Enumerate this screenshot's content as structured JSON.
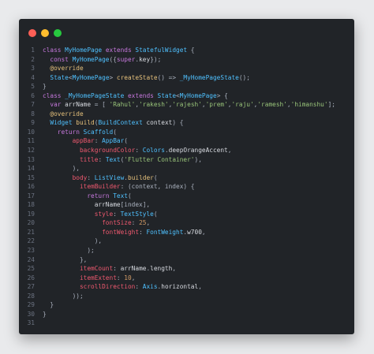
{
  "window": {
    "controls": [
      "close",
      "minimize",
      "maximize"
    ],
    "colors": {
      "background": "#212428",
      "close": "#ff5f56",
      "minimize": "#ffbd2e",
      "maximize": "#27c93f"
    }
  },
  "code_lines": [
    {
      "n": "1",
      "tokens": [
        [
          "kw",
          "class "
        ],
        [
          "type",
          "MyHomePage "
        ],
        [
          "kw",
          "extends "
        ],
        [
          "type",
          "StatefulWidget"
        ],
        [
          "punct",
          " {"
        ]
      ]
    },
    {
      "n": "2",
      "tokens": [
        [
          "plain",
          "  "
        ],
        [
          "kw",
          "const "
        ],
        [
          "type",
          "MyHomePage"
        ],
        [
          "punct",
          "({"
        ],
        [
          "kw",
          "super"
        ],
        [
          "punct",
          "."
        ],
        [
          "plain",
          "key"
        ],
        [
          "punct",
          "});"
        ]
      ]
    },
    {
      "n": "3",
      "tokens": [
        [
          "plain",
          "  "
        ],
        [
          "anno",
          "@override"
        ]
      ]
    },
    {
      "n": "4",
      "tokens": [
        [
          "plain",
          "  "
        ],
        [
          "type",
          "State"
        ],
        [
          "punct",
          "<"
        ],
        [
          "type",
          "MyHomePage"
        ],
        [
          "punct",
          "> "
        ],
        [
          "fn",
          "createState"
        ],
        [
          "punct",
          "() => "
        ],
        [
          "type",
          "_MyHomePageState"
        ],
        [
          "punct",
          "();"
        ]
      ]
    },
    {
      "n": "5",
      "tokens": [
        [
          "punct",
          "}"
        ]
      ]
    },
    {
      "n": "6",
      "tokens": [
        [
          "kw",
          "class "
        ],
        [
          "type",
          "_MyHomePageState "
        ],
        [
          "kw",
          "extends "
        ],
        [
          "type",
          "State"
        ],
        [
          "punct",
          "<"
        ],
        [
          "type",
          "MyHomePage"
        ],
        [
          "punct",
          "> {"
        ]
      ]
    },
    {
      "n": "7",
      "tokens": [
        [
          "plain",
          "  "
        ],
        [
          "kw",
          "var "
        ],
        [
          "plain",
          "arrName"
        ],
        [
          "punct",
          " = [ "
        ],
        [
          "str",
          "'Rahul'"
        ],
        [
          "punct",
          ","
        ],
        [
          "str",
          "'rakesh'"
        ],
        [
          "punct",
          ","
        ],
        [
          "str",
          "'rajesh'"
        ],
        [
          "punct",
          ","
        ],
        [
          "str",
          "'prem'"
        ],
        [
          "punct",
          ","
        ],
        [
          "str",
          "'raju'"
        ],
        [
          "punct",
          ","
        ],
        [
          "str",
          "'ramesh'"
        ],
        [
          "punct",
          ","
        ],
        [
          "str",
          "'himanshu'"
        ],
        [
          "punct",
          "];"
        ]
      ]
    },
    {
      "n": "8",
      "tokens": [
        [
          "plain",
          "  "
        ],
        [
          "anno",
          "@override"
        ]
      ]
    },
    {
      "n": "9",
      "tokens": [
        [
          "plain",
          "  "
        ],
        [
          "type",
          "Widget "
        ],
        [
          "fn",
          "build"
        ],
        [
          "punct",
          "("
        ],
        [
          "type",
          "BuildContext "
        ],
        [
          "plain",
          "context"
        ],
        [
          "punct",
          ") {"
        ]
      ]
    },
    {
      "n": "10",
      "tokens": [
        [
          "plain",
          "    "
        ],
        [
          "kw",
          "return "
        ],
        [
          "type",
          "Scaffold"
        ],
        [
          "punct",
          "("
        ]
      ]
    },
    {
      "n": "11",
      "tokens": [
        [
          "plain",
          "        "
        ],
        [
          "prop",
          "appBar"
        ],
        [
          "punct",
          ": "
        ],
        [
          "type",
          "AppBar"
        ],
        [
          "punct",
          "("
        ]
      ]
    },
    {
      "n": "12",
      "tokens": [
        [
          "plain",
          "          "
        ],
        [
          "prop",
          "backgroundColor"
        ],
        [
          "punct",
          ": "
        ],
        [
          "type",
          "Colors"
        ],
        [
          "punct",
          "."
        ],
        [
          "plain",
          "deepOrangeAccent"
        ],
        [
          "punct",
          ","
        ]
      ]
    },
    {
      "n": "13",
      "tokens": [
        [
          "plain",
          "          "
        ],
        [
          "prop",
          "title"
        ],
        [
          "punct",
          ": "
        ],
        [
          "type",
          "Text"
        ],
        [
          "punct",
          "("
        ],
        [
          "str",
          "'Flutter Container'"
        ],
        [
          "punct",
          "),"
        ]
      ]
    },
    {
      "n": "14",
      "tokens": [
        [
          "plain",
          "        "
        ],
        [
          "punct",
          "),"
        ]
      ]
    },
    {
      "n": "15",
      "tokens": [
        [
          "plain",
          "        "
        ],
        [
          "prop",
          "body"
        ],
        [
          "punct",
          ": "
        ],
        [
          "type",
          "ListView"
        ],
        [
          "punct",
          "."
        ],
        [
          "fn",
          "builder"
        ],
        [
          "punct",
          "("
        ]
      ]
    },
    {
      "n": "16",
      "tokens": [
        [
          "plain",
          "          "
        ],
        [
          "prop",
          "itemBuilder"
        ],
        [
          "punct",
          ": (context, index) {"
        ]
      ]
    },
    {
      "n": "17",
      "tokens": [
        [
          "plain",
          "            "
        ],
        [
          "kw",
          "return "
        ],
        [
          "type",
          "Text"
        ],
        [
          "punct",
          "("
        ]
      ]
    },
    {
      "n": "18",
      "tokens": [
        [
          "plain",
          "              "
        ],
        [
          "plain",
          "arrName"
        ],
        [
          "punct",
          "[index],"
        ]
      ]
    },
    {
      "n": "19",
      "tokens": [
        [
          "plain",
          "              "
        ],
        [
          "prop",
          "style"
        ],
        [
          "punct",
          ": "
        ],
        [
          "type",
          "TextStyle"
        ],
        [
          "punct",
          "("
        ]
      ]
    },
    {
      "n": "20",
      "tokens": [
        [
          "plain",
          "                "
        ],
        [
          "prop",
          "fontSize"
        ],
        [
          "punct",
          ": "
        ],
        [
          "num",
          "25"
        ],
        [
          "punct",
          ","
        ]
      ]
    },
    {
      "n": "21",
      "tokens": [
        [
          "plain",
          "                "
        ],
        [
          "prop",
          "fontWeight"
        ],
        [
          "punct",
          ": "
        ],
        [
          "type",
          "FontWeight"
        ],
        [
          "punct",
          "."
        ],
        [
          "plain",
          "w700"
        ],
        [
          "punct",
          ","
        ]
      ]
    },
    {
      "n": "22",
      "tokens": [
        [
          "plain",
          "              "
        ],
        [
          "punct",
          "),"
        ]
      ]
    },
    {
      "n": "23",
      "tokens": [
        [
          "plain",
          "            "
        ],
        [
          "punct",
          ");"
        ]
      ]
    },
    {
      "n": "24",
      "tokens": [
        [
          "plain",
          "          "
        ],
        [
          "punct",
          "},"
        ]
      ]
    },
    {
      "n": "25",
      "tokens": [
        [
          "plain",
          "          "
        ],
        [
          "prop",
          "itemCount"
        ],
        [
          "punct",
          ": "
        ],
        [
          "plain",
          "arrName"
        ],
        [
          "punct",
          "."
        ],
        [
          "plain",
          "length"
        ],
        [
          "punct",
          ","
        ]
      ]
    },
    {
      "n": "26",
      "tokens": [
        [
          "plain",
          "          "
        ],
        [
          "prop",
          "itemExtent"
        ],
        [
          "punct",
          ": "
        ],
        [
          "num",
          "10"
        ],
        [
          "punct",
          ","
        ]
      ]
    },
    {
      "n": "27",
      "tokens": [
        [
          "plain",
          "          "
        ],
        [
          "prop",
          "scrollDirection"
        ],
        [
          "punct",
          ": "
        ],
        [
          "type",
          "Axis"
        ],
        [
          "punct",
          "."
        ],
        [
          "plain",
          "horizontal"
        ],
        [
          "punct",
          ","
        ]
      ]
    },
    {
      "n": "28",
      "tokens": [
        [
          "plain",
          "        "
        ],
        [
          "punct",
          "));"
        ]
      ]
    },
    {
      "n": "29",
      "tokens": [
        [
          "plain",
          "  "
        ],
        [
          "punct",
          "}"
        ]
      ]
    },
    {
      "n": "30",
      "tokens": [
        [
          "punct",
          "}"
        ]
      ]
    },
    {
      "n": "31",
      "tokens": []
    }
  ]
}
